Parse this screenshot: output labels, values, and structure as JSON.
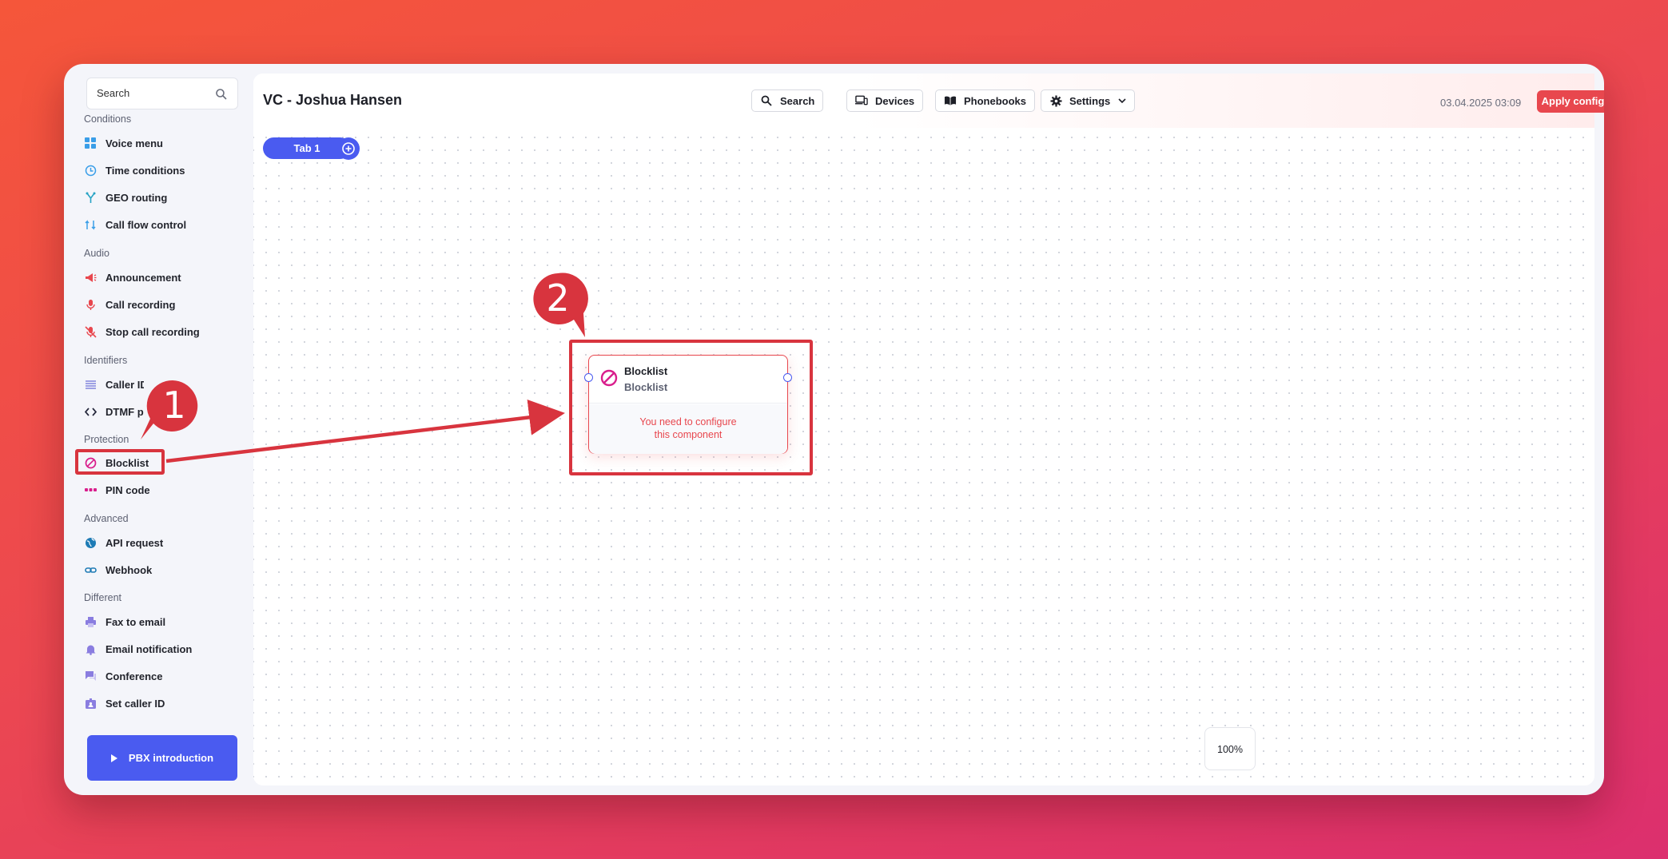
{
  "sidebar": {
    "search_label": "Search",
    "sections": [
      {
        "title": "Conditions",
        "items": [
          {
            "label": "Voice menu",
            "icon": "grid-icon"
          },
          {
            "label": "Time conditions",
            "icon": "clock-icon"
          },
          {
            "label": "GEO routing",
            "icon": "geo-routing-icon"
          },
          {
            "label": "Call flow control",
            "icon": "flow-icon"
          }
        ]
      },
      {
        "title": "Audio",
        "items": [
          {
            "label": "Announcement",
            "icon": "megaphone-icon"
          },
          {
            "label": "Call recording",
            "icon": "microphone-icon"
          },
          {
            "label": "Stop call recording",
            "icon": "microphone-off-icon"
          }
        ]
      },
      {
        "title": "Identifiers",
        "items": [
          {
            "label": "Caller ID prefix",
            "icon": "list-icon"
          },
          {
            "label": "DTMF prompt",
            "icon": "code-icon"
          }
        ]
      },
      {
        "title": "Protection",
        "items": [
          {
            "label": "Blocklist",
            "icon": "ban-icon"
          },
          {
            "label": "PIN code",
            "icon": "dots-icon"
          }
        ]
      },
      {
        "title": "Advanced",
        "items": [
          {
            "label": "API request",
            "icon": "globe-icon"
          },
          {
            "label": "Webhook",
            "icon": "link-icon"
          }
        ]
      },
      {
        "title": "Different",
        "items": [
          {
            "label": "Fax to email",
            "icon": "printer-icon"
          },
          {
            "label": "Email notification",
            "icon": "bell-icon"
          },
          {
            "label": "Conference",
            "icon": "chat-icon"
          },
          {
            "label": "Set caller ID",
            "icon": "id-card-icon"
          }
        ]
      }
    ],
    "pbx_button": "PBX introduction"
  },
  "header": {
    "title": "VC - Joshua Hansen",
    "search": "Search",
    "devices": "Devices",
    "phonebooks": "Phonebooks",
    "settings": "Settings",
    "timestamp": "03.04.2025 03:09",
    "apply": "Apply configuration"
  },
  "canvas": {
    "tab": "Tab 1",
    "zoom": "100%",
    "node": {
      "title": "Blocklist",
      "subtitle": "Blocklist",
      "warning": "You need to configure this component"
    }
  },
  "annotations": {
    "step1": "1",
    "step2": "2"
  },
  "colors": {
    "accent": "#4a5bf0",
    "danger": "#e8474e",
    "annotation": "#d8343e"
  }
}
